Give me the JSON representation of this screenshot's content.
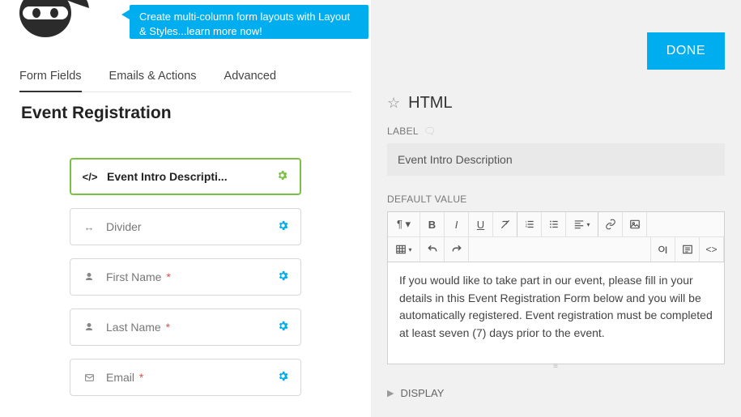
{
  "banner": {
    "text": "Create multi-column form layouts with Layout & Styles...learn more now!"
  },
  "tabs": [
    {
      "label": "Form Fields",
      "active": true
    },
    {
      "label": "Emails & Actions",
      "active": false
    },
    {
      "label": "Advanced",
      "active": false
    }
  ],
  "form_title": "Event Registration",
  "fields": [
    {
      "icon": "code",
      "label": "Event Intro Descripti...",
      "required": false,
      "selected": true
    },
    {
      "icon": "arrows",
      "label": "Divider",
      "required": false,
      "selected": false
    },
    {
      "icon": "person",
      "label": "First Name",
      "required": true,
      "selected": false
    },
    {
      "icon": "person",
      "label": "Last Name",
      "required": true,
      "selected": false
    },
    {
      "icon": "envelope",
      "label": "Email",
      "required": true,
      "selected": false
    }
  ],
  "right": {
    "done": "DONE",
    "panel_title": "HTML",
    "label_section": "LABEL",
    "label_value": "Event Intro Description",
    "default_value_section": "DEFAULT VALUE",
    "editor_text": "If you would like to take part in our event, please fill in your details in this Event Registration Form below and you will be automatically registered. Event registration must be completed at least seven (7) days prior to the event.",
    "display_section": "DISPLAY"
  }
}
